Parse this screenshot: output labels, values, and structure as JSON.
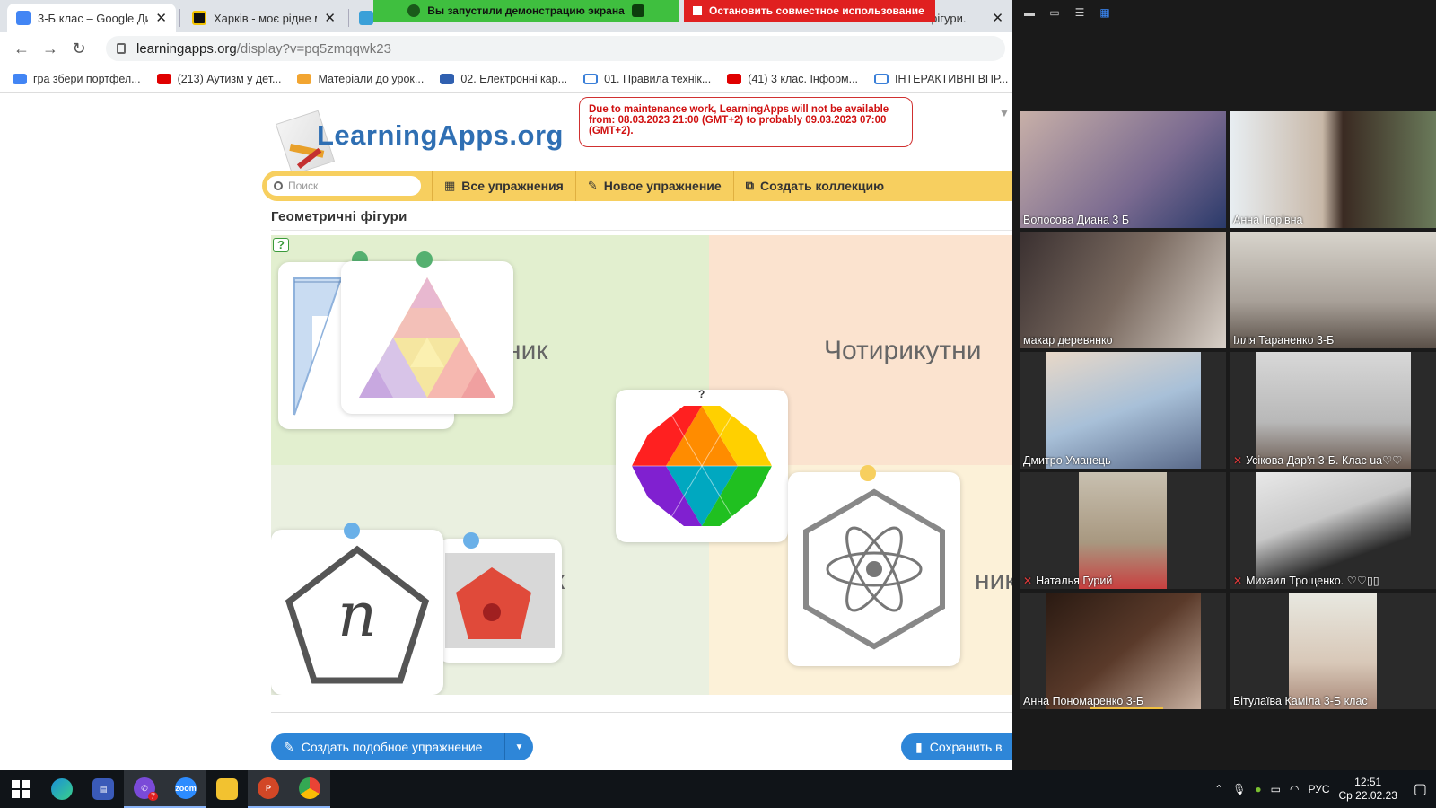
{
  "browser": {
    "tabs": [
      {
        "title": "3-Б клас – Google Ди",
        "color": "#4285f4"
      },
      {
        "title": "Харків - моє рідне мі",
        "color": "#111111"
      },
      {
        "title": "ні фігури.",
        "color": "#3aa0d8"
      }
    ],
    "share_banner": "Вы запустили демонстрацию экрана",
    "share_stop": "Остановить совместное использование",
    "url_host": "learningapps.org",
    "url_path": "/display?v=pq5zmqqwk23",
    "bookmarks": [
      {
        "label": "гра збери портфел...",
        "color": "#4285f4"
      },
      {
        "label": "(213) Аутизм у дет...",
        "color": "#e00000"
      },
      {
        "label": "Матеріали до урок...",
        "color": "#f2a531"
      },
      {
        "label": "02. Електронні кар...",
        "color": "#3060b0"
      },
      {
        "label": "01. Правила технік...",
        "color": "#3a7fd8"
      },
      {
        "label": "(41) 3 клас. Інформ...",
        "color": "#e00000"
      },
      {
        "label": "ІНТЕРАКТИВНІ ВПР...",
        "color": "#3a7fd8"
      }
    ]
  },
  "site": {
    "logo": "LearningApps.org",
    "maintenance": "Due to maintenance work, LearningApps will not be available from: 08.03.2023 21:00 (GMT+2) to probably 09.03.2023 07:00 (GMT+2).",
    "search_placeholder": "Поиск",
    "nav": [
      "Все упражнения",
      "Новое упражнение",
      "Создать коллекцию"
    ],
    "exercise_title": "Геометричні фігури",
    "categories": {
      "tl": "ник",
      "tr": "Чотирикутни",
      "bl": "к",
      "br": "ник"
    },
    "card_question": "?",
    "card_letter": "n",
    "create_similar": "Создать подобное упражнение",
    "save": "Сохранить в"
  },
  "zoom": {
    "participants": [
      {
        "name": "Волосова Диана 3 Б",
        "muted": false
      },
      {
        "name": "Анна Ігорівна",
        "muted": false
      },
      {
        "name": "макар  деревянко",
        "muted": false
      },
      {
        "name": "Ілля Тараненко 3-Б",
        "muted": false
      },
      {
        "name": "Дмитро Уманець",
        "muted": false
      },
      {
        "name": "Усікова Дар'я 3-Б. Клас ua♡♡",
        "muted": true
      },
      {
        "name": "Наталья Гурий",
        "muted": true
      },
      {
        "name": "Михаил Трощенко. ♡♡▯▯",
        "muted": true
      },
      {
        "name": "Анна Пономаренко 3-Б",
        "muted": false
      },
      {
        "name": "Бітулаїва Каміла 3-Б клас",
        "muted": false
      }
    ]
  },
  "taskbar": {
    "lang": "РУС",
    "time": "12:51",
    "date": "Ср 22.02.23",
    "badge": "7",
    "zoom_label": "zoom"
  }
}
